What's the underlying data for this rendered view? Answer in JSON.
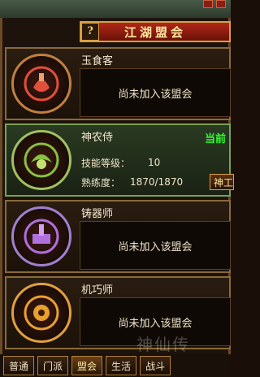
{
  "window": {
    "title": "江湖盟会",
    "help_label": "?"
  },
  "guilds": [
    {
      "name": "玉食客",
      "status": "尚未加入该盟会",
      "emblem": "chef-emblem-icon",
      "color": "#e0503a"
    },
    {
      "name": "神农侍",
      "current_label": "当前",
      "emblem": "herb-emblem-icon",
      "color": "#88c040",
      "stats": [
        {
          "label": "技能等级：",
          "value": "10"
        },
        {
          "label": "熟练度：",
          "value": "1870/1870"
        }
      ],
      "skill_button": "神工"
    },
    {
      "name": "铸器师",
      "status": "尚未加入该盟会",
      "emblem": "forge-emblem-icon",
      "color": "#b070e0"
    },
    {
      "name": "机巧师",
      "status": "尚未加入该盟会",
      "emblem": "gear-emblem-icon",
      "color": "#e8a030"
    }
  ],
  "tabs": [
    "普通",
    "门派",
    "盟会",
    "生活",
    "战斗"
  ],
  "selected_tab": "盟会",
  "watermark": "神仙传"
}
